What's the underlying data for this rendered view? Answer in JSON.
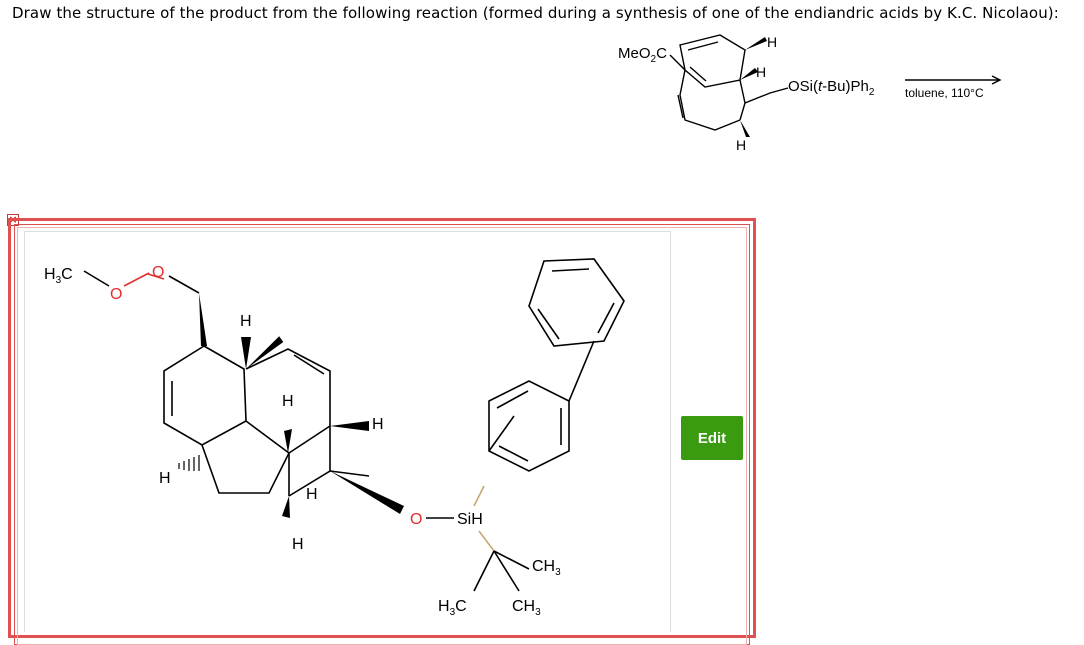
{
  "question": {
    "text": "Draw the structure of the product from the following reaction (formed during a synthesis of one of the endiandric acids by K.C. Nicolaou):"
  },
  "reaction": {
    "ester_label": "MeO",
    "ester_sub": "2",
    "ester_c": "C",
    "h_top": "H",
    "h_mid": "H",
    "h_bottom": "H",
    "silyl_group": "OSi(",
    "silyl_t": "t",
    "silyl_rest": "-Bu)Ph",
    "silyl_sub": "2",
    "conditions": "toluene, 110°C"
  },
  "product": {
    "methyl_h": "H",
    "methyl_sub": "3",
    "methyl_c": "C",
    "ester_o1": "O",
    "ester_o2": "O",
    "h1": "H",
    "h2": "H",
    "h3": "H",
    "h4": "H",
    "h5": "H",
    "h6": "H",
    "o_silyl": "O",
    "si_label": "SiH",
    "ch3_right": "CH",
    "ch3_right_sub": "3",
    "h3c_bottom_h": "H",
    "h3c_bottom_sub": "3",
    "h3c_bottom_c": "C",
    "ch3_bottom": "CH",
    "ch3_bottom_sub": "3"
  },
  "edit_button": {
    "label": "Edit"
  },
  "colors": {
    "accent_green": "#3a9a10",
    "frame_red": "#e05050",
    "bond_tan": "#c8a870"
  }
}
